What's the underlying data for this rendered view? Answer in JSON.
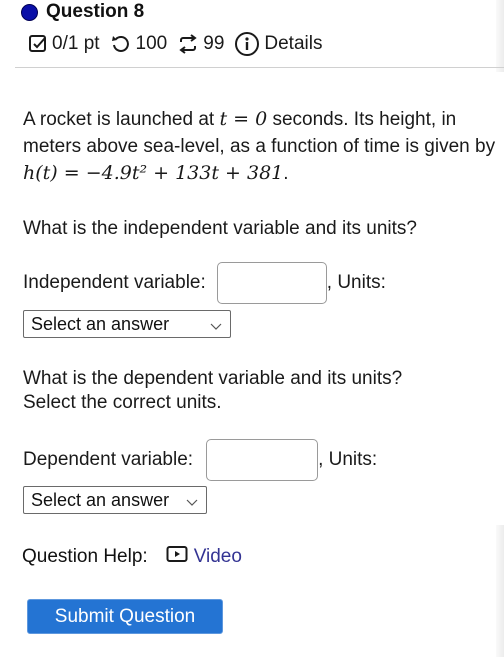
{
  "header": {
    "title": "Question 8",
    "status_color": "#0a0fa8",
    "meta": {
      "points": "0/1 pt",
      "retries": "100",
      "attempts": "99",
      "details": "Details"
    },
    "icons": [
      "checkbox-icon",
      "undo-icon",
      "repeat-icon",
      "info-icon"
    ]
  },
  "question": {
    "intro_part1": "A rocket is launched at",
    "t_eq_0": "t = 0",
    "intro_part2": "seconds. Its height, in meters above sea-level, as a function of time is given by",
    "formula": "h(t) = −4.9t² + 133t + 381",
    "formula_end": ".",
    "q1": "What is the independent variable and its units?",
    "q2_line1": "What is the dependent variable and its units?",
    "q2_line2": "Select the correct units."
  },
  "independent": {
    "label": "Independent variable:",
    "value": "",
    "units_label": ", Units:",
    "select_value": "Select an answer"
  },
  "dependent": {
    "label": "Dependent variable:",
    "value": "",
    "units_label": ", Units:",
    "select_value": "Select an answer"
  },
  "help": {
    "label": "Question Help:",
    "video_label": "Video",
    "link_color": "#343493"
  },
  "submit": {
    "label": "Submit Question",
    "color": "#2474d3"
  }
}
